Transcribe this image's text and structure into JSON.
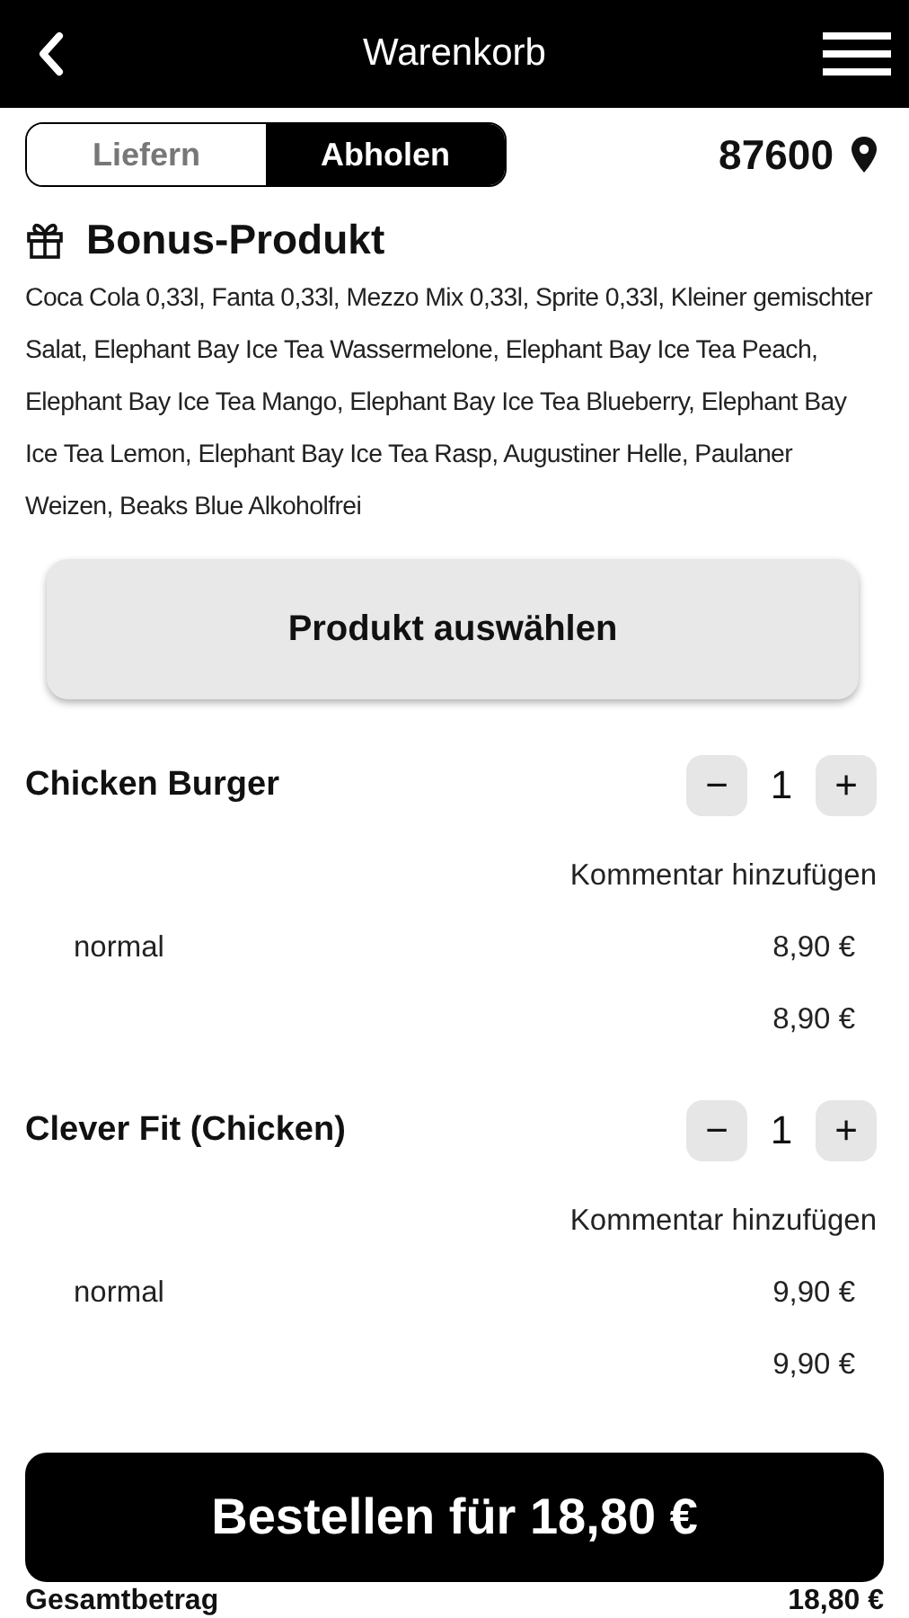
{
  "header": {
    "title": "Warenkorb"
  },
  "mode_tabs": [
    {
      "label": "Liefern",
      "selected": false
    },
    {
      "label": "Abholen",
      "selected": true
    }
  ],
  "postal_code": "87600",
  "bonus": {
    "title": "Bonus-Produkt",
    "products": "Coca Cola 0,33l, Fanta 0,33l, Mezzo Mix 0,33l, Sprite 0,33l, Kleiner gemischter Salat, Elephant Bay Ice Tea Wassermelone, Elephant Bay Ice Tea Peach, Elephant Bay Ice Tea Mango, Elephant Bay Ice Tea Blueberry, Elephant Bay Ice Tea Lemon, Elephant Bay Ice Tea Rasp, Augustiner Helle, Paulaner Weizen, Beaks Blue Alkoholfrei",
    "button": "Produkt auswählen"
  },
  "items": [
    {
      "name": "Chicken Burger",
      "quantity": "1",
      "minus": "−",
      "plus": "+",
      "comment_link": "Kommentar hinzufügen",
      "options": [
        {
          "name": "normal",
          "price": "8,90 €"
        }
      ],
      "subtotal": "8,90 €"
    },
    {
      "name": "Clever Fit (Chicken)",
      "quantity": "1",
      "minus": "−",
      "plus": "+",
      "comment_link": "Kommentar hinzufügen",
      "options": [
        {
          "name": "normal",
          "price": "9,90 €"
        }
      ],
      "subtotal": "9,90 €"
    }
  ],
  "order_button": "Bestellen für 18,80 €",
  "total": {
    "label": "Gesamtbetrag",
    "amount": "18,80 €"
  }
}
